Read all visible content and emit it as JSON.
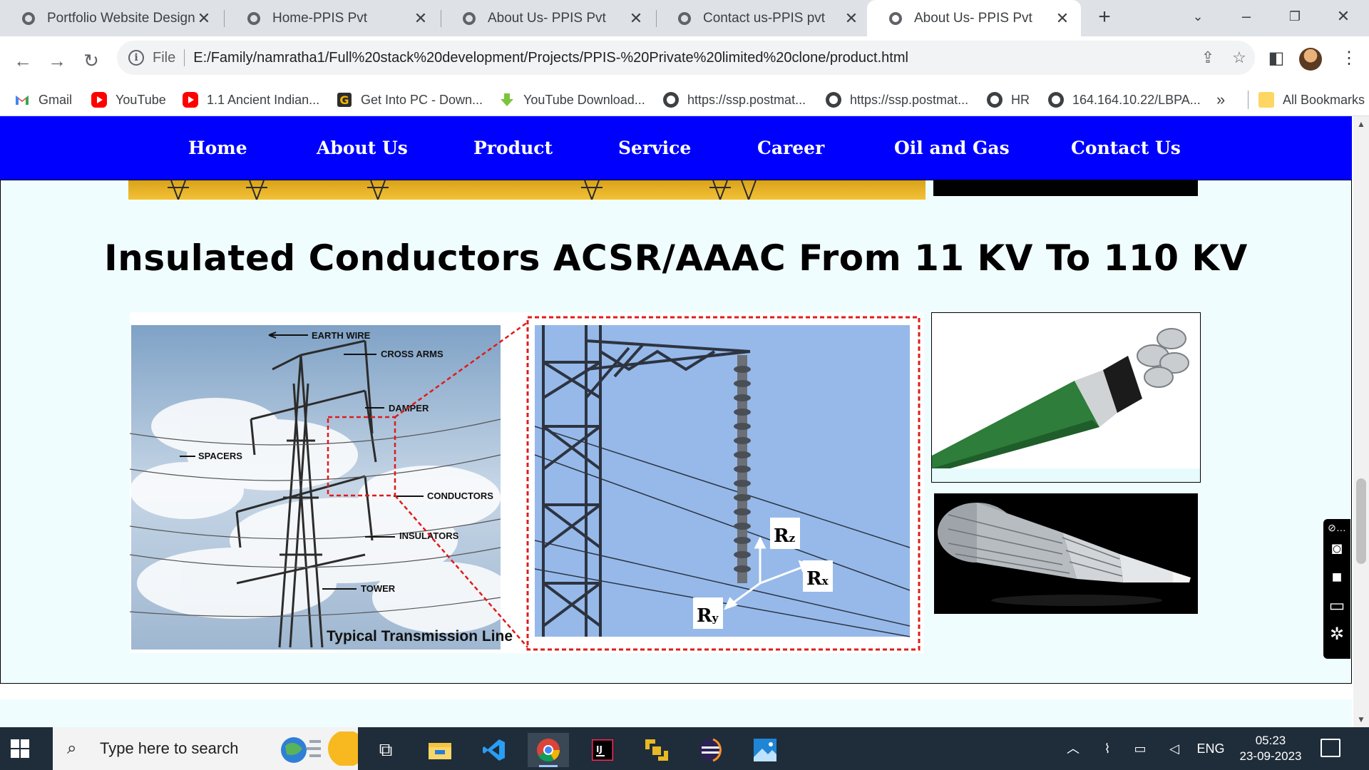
{
  "browser": {
    "tabs": [
      {
        "title": "Portfolio Website Design-",
        "active": false
      },
      {
        "title": "Home-PPIS Pvt",
        "active": false
      },
      {
        "title": "About Us- PPIS Pvt",
        "active": false
      },
      {
        "title": "Contact us-PPIS pvt",
        "active": false
      },
      {
        "title": "About Us- PPIS Pvt",
        "active": true
      }
    ],
    "new_tab": "+",
    "address": {
      "scheme": "File",
      "url": "E:/Family/namratha1/Full%20stack%20development/Projects/PPIS-%20Private%20limited%20clone/product.html"
    },
    "bookmarks": [
      {
        "label": "Gmail",
        "icon": "gmail-icon"
      },
      {
        "label": "YouTube",
        "icon": "youtube-icon"
      },
      {
        "label": "1.1 Ancient Indian...",
        "icon": "youtube-icon"
      },
      {
        "label": "Get Into PC - Down...",
        "icon": "getintopc-icon"
      },
      {
        "label": "YouTube Download...",
        "icon": "download-arrow-icon"
      },
      {
        "label": "https://ssp.postmat...",
        "icon": "globe-icon"
      },
      {
        "label": "https://ssp.postmat...",
        "icon": "globe-icon"
      },
      {
        "label": "HR",
        "icon": "globe-icon"
      },
      {
        "label": "164.164.10.22/LBPA...",
        "icon": "globe-icon"
      }
    ],
    "bookmarks_overflow": "»",
    "all_bookmarks": "All Bookmarks"
  },
  "site": {
    "nav": [
      "Home",
      "About Us",
      "Product",
      "Service",
      "Career",
      "Oil and Gas",
      "Contact Us"
    ],
    "heading": "Insulated Conductors ACSR/AAAC From 11 KV To 110 KV",
    "figure": {
      "labels": {
        "earth_wire": "EARTH WIRE",
        "cross_arms": "CROSS ARMS",
        "damper": "DAMPER",
        "spacers": "SPACERS",
        "conductors": "CONDUCTORS",
        "insulators": "INSULATORS",
        "tower": "TOWER",
        "caption": "Typical Transmission Line",
        "rz": "R",
        "rz_sub": "z",
        "rx": "R",
        "rx_sub": "x",
        "ry": "R",
        "ry_sub": "y"
      }
    }
  },
  "taskbar": {
    "search_placeholder": "Type here to search",
    "apps": [
      "task-view-icon",
      "file-explorer-icon",
      "vscode-icon",
      "chrome-icon",
      "intellij-icon",
      "app-icon",
      "eclipse-icon",
      "photos-icon"
    ],
    "language": "ENG",
    "time": "05:23",
    "date": "23-09-2023"
  },
  "colors": {
    "nav_bg": "#0000ff",
    "page_bg": "#f0fdff",
    "chrome_tabstrip": "#dee1e6",
    "taskbar": "#1f2d3a"
  }
}
